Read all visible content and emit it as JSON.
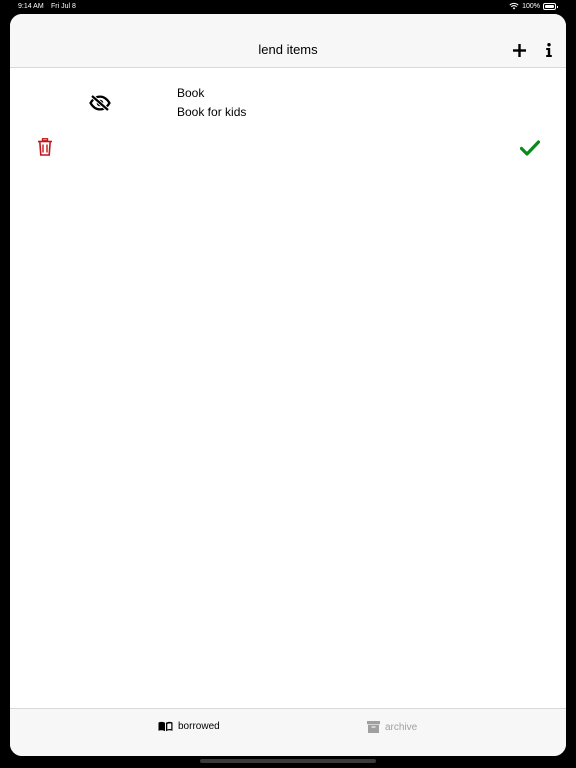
{
  "status_bar": {
    "time": "9:14 AM",
    "date": "Fri Jul 8",
    "battery": "100%"
  },
  "nav": {
    "title": "lend items",
    "add_icon": "plus-icon",
    "info_icon": "info-icon"
  },
  "items": [
    {
      "title": "Book",
      "subtitle": "Book for kids",
      "visibility_icon": "eye-slash-icon",
      "delete_icon": "trash-icon",
      "return_icon": "checkmark-icon"
    }
  ],
  "tabs": [
    {
      "label": "borrowed",
      "icon": "open-book-icon",
      "selected": true
    },
    {
      "label": "archive",
      "icon": "archive-box-icon",
      "selected": false
    }
  ],
  "colors": {
    "delete": "#c0161c",
    "checkmark": "#0a8a1a",
    "tab_inactive": "#a0a0a0",
    "bar_background": "#f7f7f7"
  }
}
